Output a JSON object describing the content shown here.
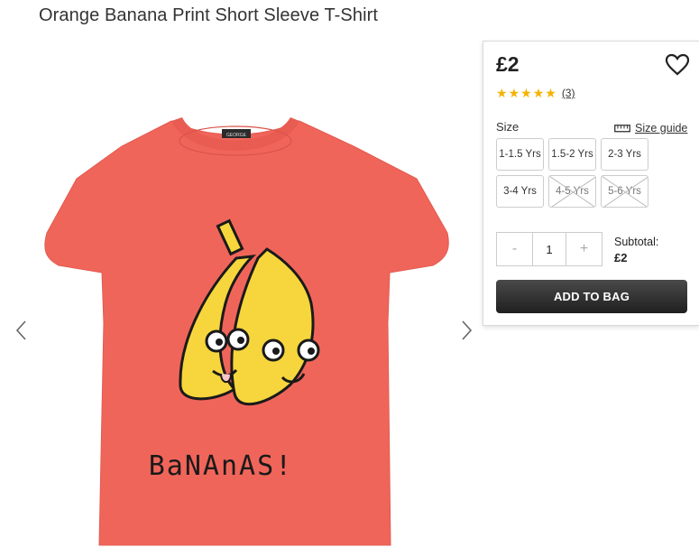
{
  "product": {
    "title": "Orange Banana Print Short Sleeve T-Shirt",
    "image_alt": "Orange t-shirt with banana print",
    "print_text": "BaNAnAS!",
    "neck_label": "GEORGE"
  },
  "gallery": {
    "prev_icon": "chevron-left-icon",
    "next_icon": "chevron-right-icon"
  },
  "purchase": {
    "price": "£2",
    "wishlist_icon": "heart-outline-icon",
    "rating": 5,
    "review_count": "(3)",
    "size_label": "Size",
    "size_guide_label": "Size guide",
    "size_guide_icon": "ruler-icon",
    "sizes": [
      {
        "label": "1-1.5 Yrs",
        "available": true
      },
      {
        "label": "1.5-2 Yrs",
        "available": true
      },
      {
        "label": "2-3 Yrs",
        "available": true
      },
      {
        "label": "3-4 Yrs",
        "available": true
      },
      {
        "label": "4-5 Yrs",
        "available": false
      },
      {
        "label": "5-6 Yrs",
        "available": false
      }
    ],
    "quantity": {
      "decrement": "-",
      "value": "1",
      "increment": "+"
    },
    "subtotal_label": "Subtotal:",
    "subtotal_value": "£2",
    "add_to_bag_label": "ADD TO BAG"
  },
  "colors": {
    "star": "#f5b301",
    "shirt": "#f0655a",
    "banana": "#f6d63c",
    "button_dark": "#222222"
  }
}
